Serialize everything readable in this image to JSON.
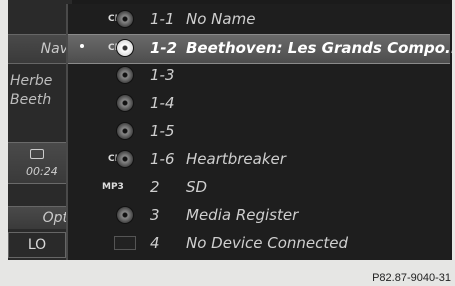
{
  "background_panel": {
    "nav_label": "Nav",
    "info_line1": "Herbe",
    "info_line2": "Beeth",
    "time": "00:24",
    "option_label": "Opt",
    "lo_label": "LO"
  },
  "media_list": {
    "selected_index": 1,
    "items": [
      {
        "badge": "CD",
        "icon": "disc-icon",
        "number": "1-1",
        "name": "No Name"
      },
      {
        "badge": "CD",
        "icon": "disc-icon",
        "number": "1-2",
        "name": "Beethoven: Les Grands Compo..."
      },
      {
        "badge": "",
        "icon": "disc-icon",
        "number": "1-3",
        "name": ""
      },
      {
        "badge": "",
        "icon": "disc-icon",
        "number": "1-4",
        "name": ""
      },
      {
        "badge": "",
        "icon": "disc-icon",
        "number": "1-5",
        "name": ""
      },
      {
        "badge": "CD",
        "icon": "disc-icon",
        "number": "1-6",
        "name": "Heartbreaker"
      },
      {
        "badge": "MP3",
        "icon": "card-icon",
        "number": "2",
        "name": "SD"
      },
      {
        "badge": "",
        "icon": "disc-icon",
        "number": "3",
        "name": "Media Register"
      },
      {
        "badge": "",
        "icon": "device-icon",
        "number": "4",
        "name": "No Device Connected"
      }
    ]
  },
  "caption": "P82.87-9040-31"
}
